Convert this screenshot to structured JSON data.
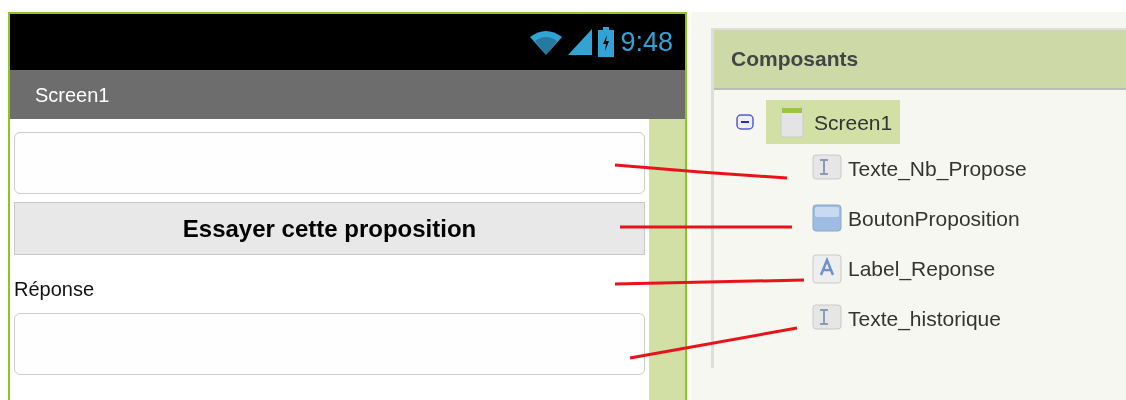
{
  "phone": {
    "status_time": "9:48",
    "title": "Screen1",
    "components": [
      {
        "kind": "textbox"
      },
      {
        "kind": "button",
        "text": "Essayer cette proposition"
      },
      {
        "kind": "label",
        "text": "Réponse"
      },
      {
        "kind": "textbox"
      }
    ]
  },
  "components_panel": {
    "title": "Composants",
    "tree": [
      {
        "label": "Screen1",
        "kind": "screen",
        "selected": true,
        "expanded": true,
        "children": [
          {
            "label": "Texte_Nb_Propose",
            "kind": "textbox",
            "selected": false
          },
          {
            "label": "BoutonProposition",
            "kind": "button",
            "selected": false
          },
          {
            "label": "Label_Reponse",
            "kind": "label",
            "selected": false
          },
          {
            "label": "Texte_historique",
            "kind": "textbox",
            "selected": false
          }
        ]
      }
    ]
  }
}
